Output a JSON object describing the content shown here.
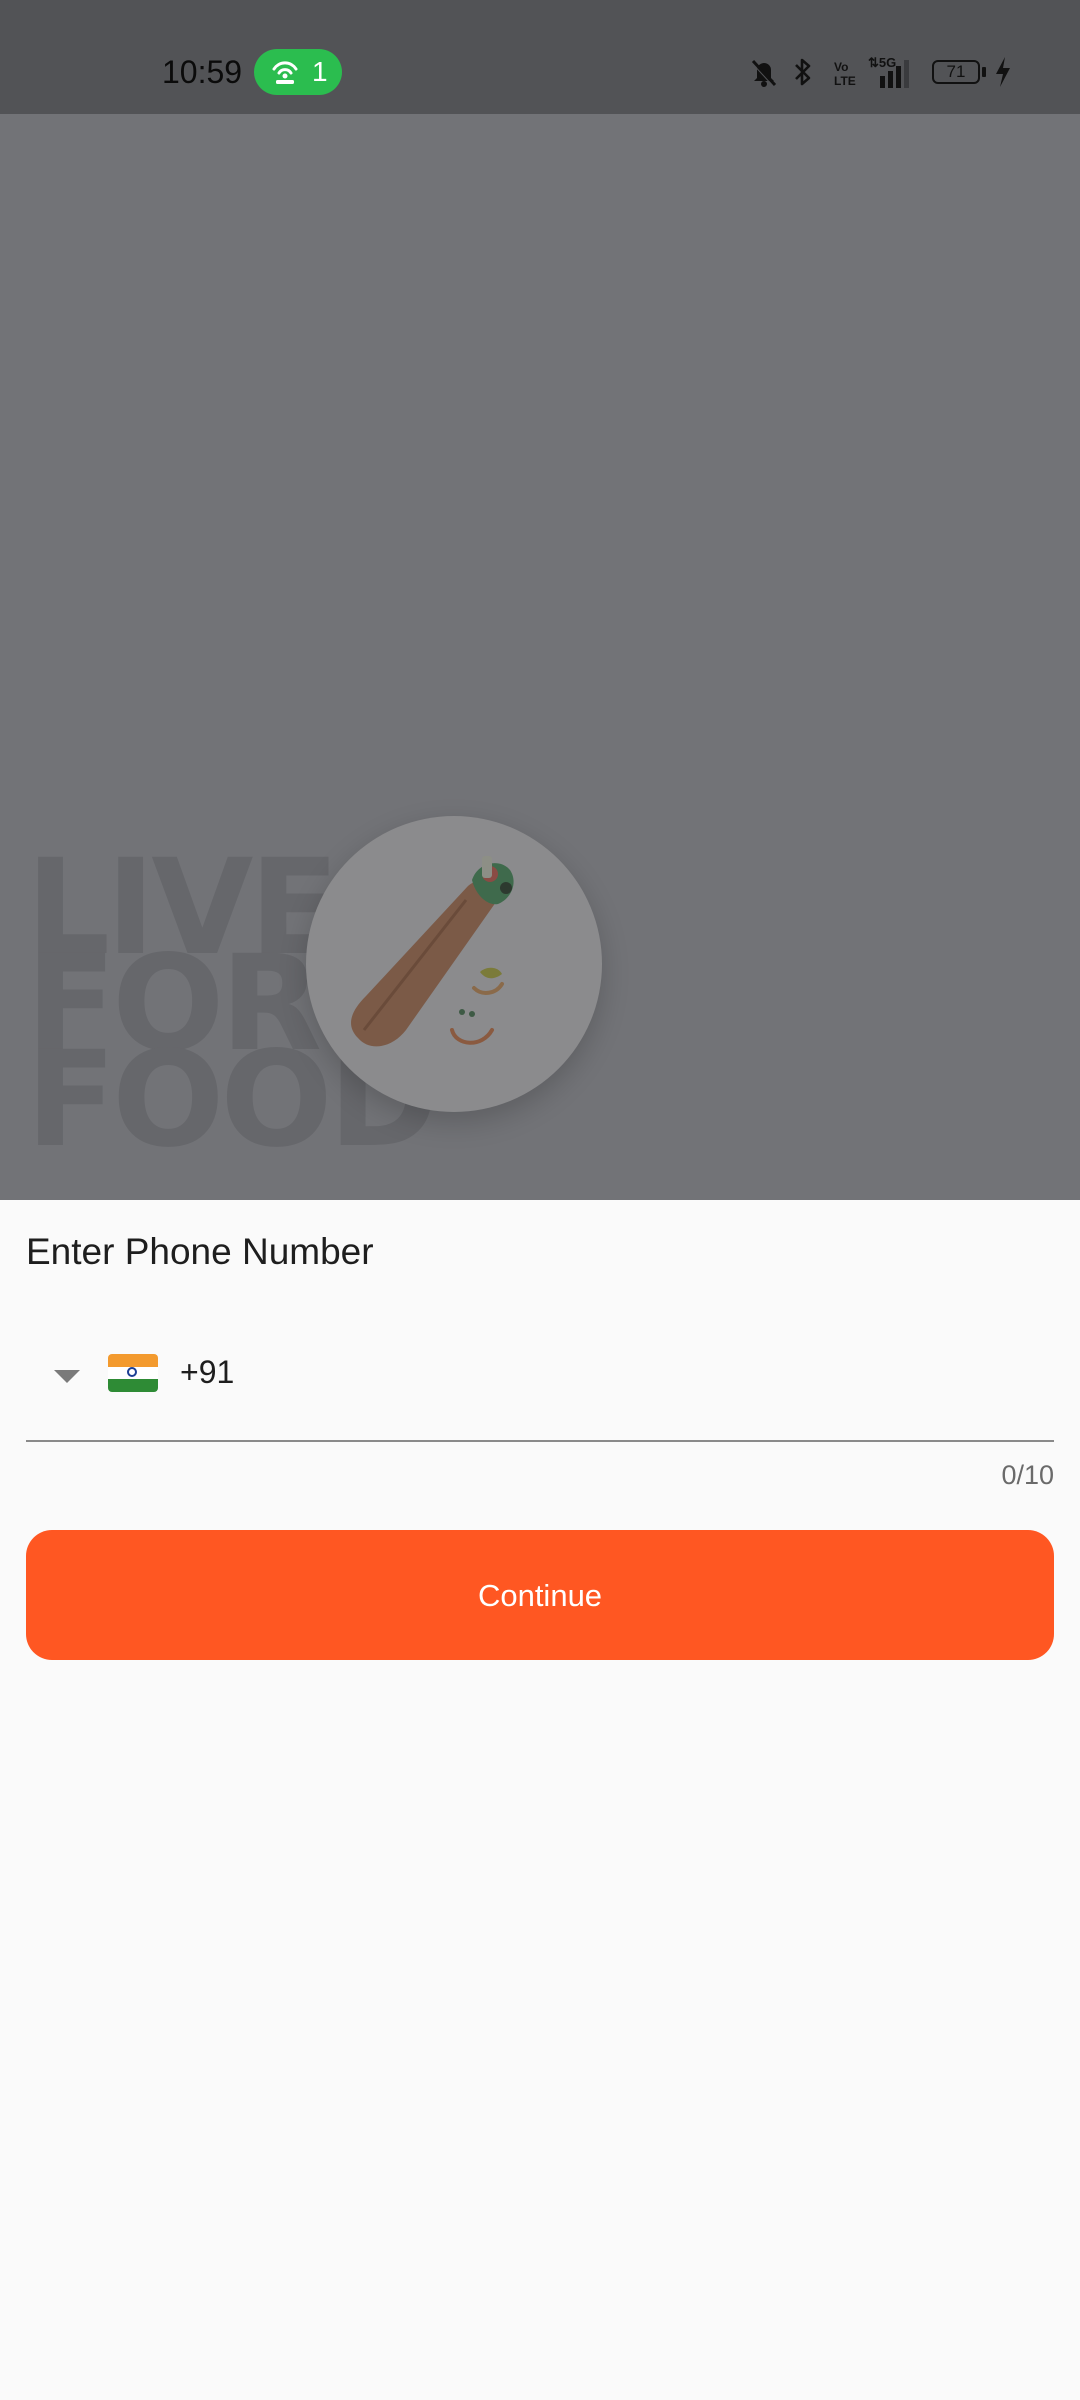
{
  "status_bar": {
    "time": "10:59",
    "hotspot_count": "1",
    "battery_level": "71",
    "icons": [
      "hotspot-icon",
      "mute-icon",
      "bluetooth-icon",
      "volte-icon",
      "signal-5g-icon",
      "battery-icon",
      "charging-icon"
    ]
  },
  "hero": {
    "slogan_lines": [
      "LIVE",
      "FOR",
      "FOOD"
    ]
  },
  "login": {
    "title": "Enter Phone Number",
    "country_flag": "india-flag-icon",
    "dial_code": "+91",
    "phone_value": "",
    "counter": "0/10",
    "continue_label": "Continue"
  },
  "colors": {
    "accent": "#ff5722",
    "hotspot_pill": "#2bbd4f",
    "scrim": "#727377",
    "sheet_background": "#fafafa"
  }
}
